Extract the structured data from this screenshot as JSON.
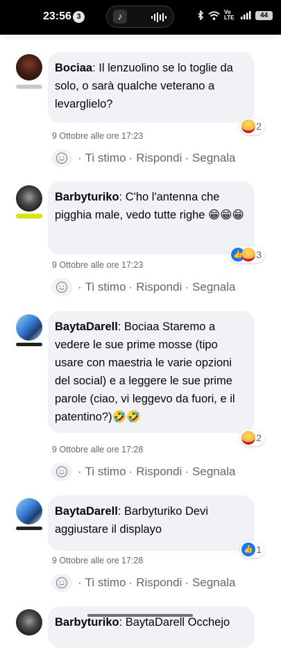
{
  "status_bar": {
    "time": "23:56",
    "notification_count": "3",
    "network": "Vo LTE",
    "battery": "44",
    "icons": [
      "music-icon",
      "audio-wave-icon",
      "bluetooth-icon",
      "wifi-icon",
      "signal-icon",
      "battery-icon"
    ]
  },
  "actions": {
    "like_label": "Ti stimo",
    "reply_label": "Rispondi",
    "report_label": "Segnala",
    "separator": "·"
  },
  "comments": [
    {
      "author": "Bociaa",
      "text": ": Il lenzuolino se lo toglie da solo, o sarà qualche veterano a levarglielo?",
      "timestamp": "9 Ottobre alle ore 17:23",
      "reactions": [
        "haha"
      ],
      "reaction_count": "2"
    },
    {
      "author": "Barbyturiko",
      "text": ": C'ho l'antenna che pigghia male, vedo tutte righe 😁😁😁",
      "timestamp": "9 Ottobre alle ore 17:23",
      "reactions": [
        "like",
        "haha"
      ],
      "reaction_count": "3"
    },
    {
      "author": "BaytaDarell",
      "text": ": Bociaa Staremo a vedere le sue prime mosse (tipo usare con maestria le varie opzioni del social) e a leggere le sue prime parole (ciao, vi leggevo da fuori, e il patentino?)🤣🤣",
      "timestamp": "9 Ottobre alle ore 17:28",
      "reactions": [
        "haha"
      ],
      "reaction_count": "2"
    },
    {
      "author": "BaytaDarell",
      "text": ": Barbyturiko Devi aggiustare il displayo",
      "timestamp": "9 Ottobre alle ore 17:28",
      "reactions": [
        "like"
      ],
      "reaction_count": "1"
    },
    {
      "author": "Barbyturiko",
      "text": ": BaytaDarell Occhejo"
    }
  ],
  "colors": {
    "bubble_bg": "#f0f2f5",
    "meta_text": "#65676b",
    "like_blue": "#1877f2",
    "haha_yellow": "#f7c03c"
  }
}
